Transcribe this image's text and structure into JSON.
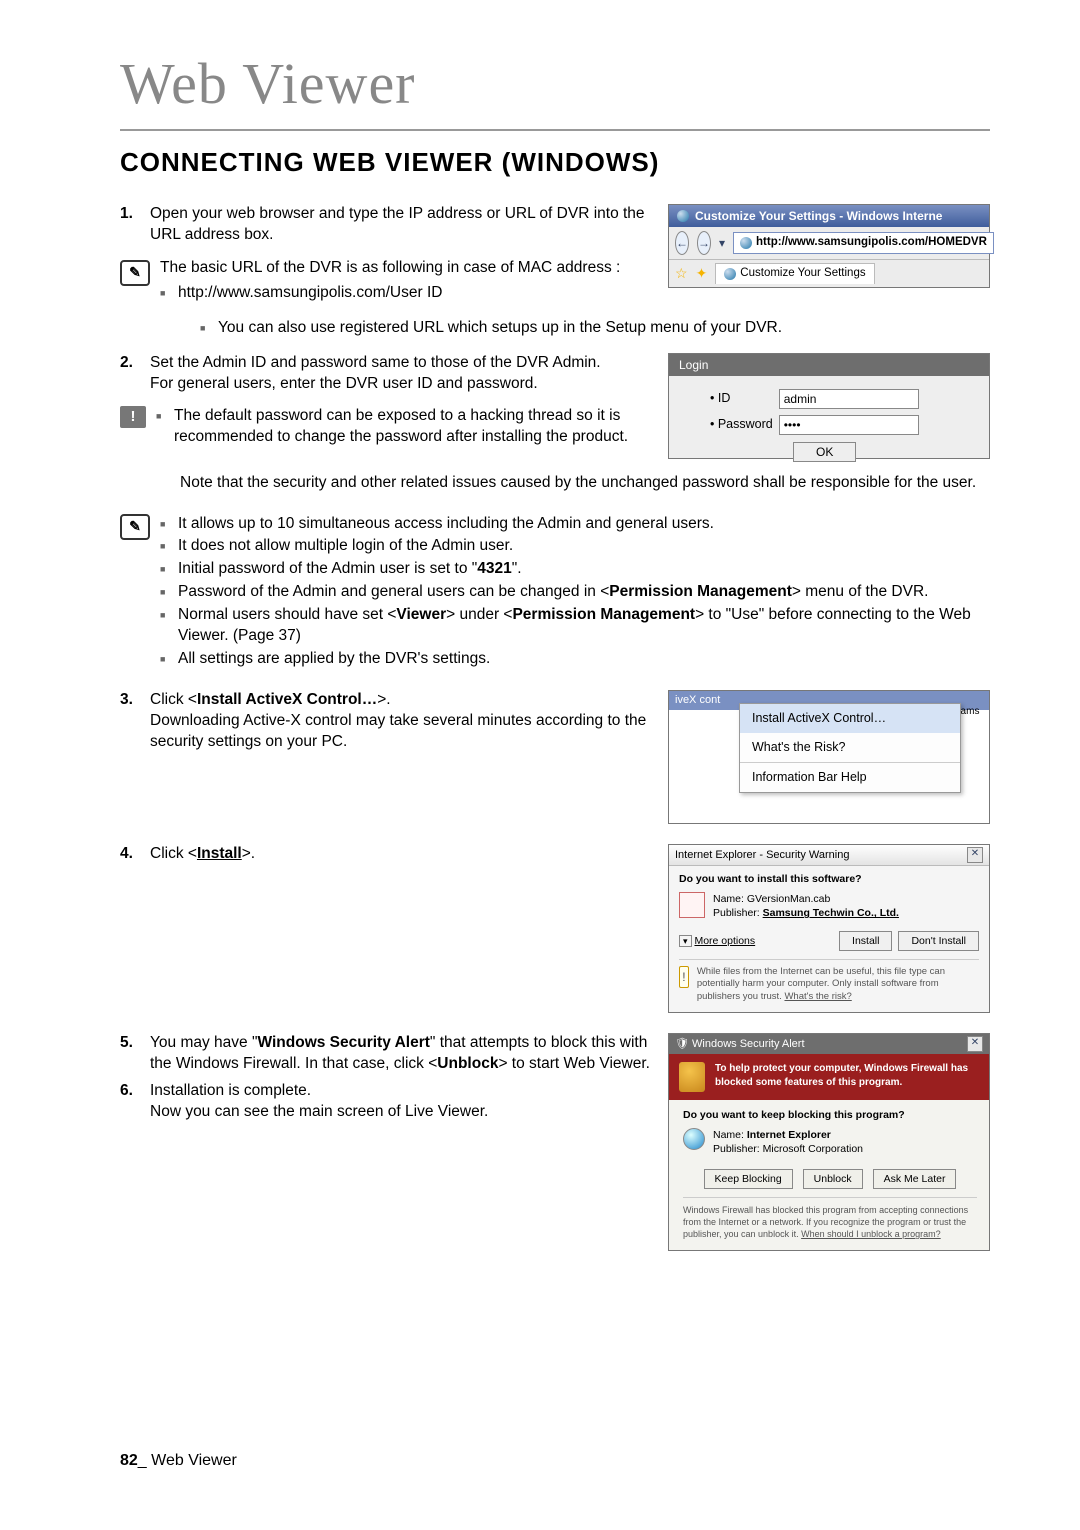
{
  "chapter_title": "Web Viewer",
  "section_heading": "CONNECTING WEB VIEWER (WINDOWS)",
  "steps": {
    "s1": {
      "num": "1.",
      "text": "Open your web browser and type the IP address or URL of DVR into the URL address box."
    },
    "note1": {
      "lead": "The basic URL of the DVR is as following in case of MAC address :",
      "b1": "http://www.samsungipolis.com/User ID",
      "b2": "You can also use registered URL which setups up in the Setup menu of your DVR."
    },
    "s2": {
      "num": "2.",
      "l1": "Set the Admin ID and password same to those of the DVR Admin.",
      "l2": "For general users, enter the DVR user ID and password."
    },
    "warn1": {
      "l1": "The default password can be exposed to a hacking thread so it is recommended to change the password after installing the product.",
      "l2": "Note that the security and other related issues caused by the unchanged password shall be responsible for the user."
    },
    "note2": {
      "b1": "It allows up to 10 simultaneous access including the Admin and general users.",
      "b2": "It does not allow multiple login of the Admin user.",
      "b3_pre": "Initial password of the Admin user is set to \"",
      "b3_bold": "4321",
      "b3_post": "\".",
      "b4_pre": "Password of the Admin and general users can be changed in <",
      "b4_bold": "Permission Management",
      "b4_post": "> menu of the DVR.",
      "b5_pre": "Normal users should have set <",
      "b5_b1": "Viewer",
      "b5_mid": "> under <",
      "b5_b2": "Permission Management",
      "b5_post": "> to \"Use\" before connecting to the Web Viewer. (Page 37)",
      "b6": "All settings are applied by the DVR's settings."
    },
    "s3": {
      "num": "3.",
      "l1_pre": "Click <",
      "l1_bold": "Install ActiveX Control…",
      "l1_post": ">.",
      "l2": "Downloading Active-X control may take several minutes according to the security settings on your PC."
    },
    "s4": {
      "num": "4.",
      "l1_pre": "Click <",
      "l1_bold": "Install",
      "l1_post": ">."
    },
    "s5": {
      "num": "5.",
      "l1_pre": "You may have \"",
      "l1_bold": "Windows Security Alert",
      "l1_mid": "\" that attempts to block this with the Windows Firewall. In that case, click <",
      "l1_bold2": "Unblock",
      "l1_post": "> to start Web Viewer."
    },
    "s6": {
      "num": "6.",
      "l1": "Installation is complete.",
      "l2": "Now you can see the main screen of Live Viewer."
    }
  },
  "ie_shot": {
    "title": "Customize Your Settings - Windows Interne",
    "url": "http://www.samsungipolis.com/HOMEDVR",
    "tab": "Customize Your Settings"
  },
  "login_shot": {
    "title": "Login",
    "id_label": "• ID",
    "id_value": "admin",
    "pw_label": "• Password",
    "pw_value": "••••",
    "ok": "OK"
  },
  "ax_shot": {
    "bar_left": "iveX cont",
    "bar_right": "ams",
    "m1": "Install ActiveX Control…",
    "m2": "What's the Risk?",
    "m3": "Information Bar Help"
  },
  "sw_shot": {
    "title": "Internet Explorer - Security Warning",
    "q": "Do you want to install this software?",
    "name_label": "Name:",
    "name_value": "GVersionMan.cab",
    "pub_label": "Publisher:",
    "pub_value": "Samsung Techwin Co., Ltd.",
    "more": "More options",
    "install": "Install",
    "dont": "Don't Install",
    "info": "While files from the Internet can be useful, this file type can potentially harm your computer. Only install software from publishers you trust.",
    "info_link": "What's the risk?"
  },
  "fw_shot": {
    "title": "Windows Security Alert",
    "banner": "To help protect your computer, Windows Firewall has blocked some features of this program.",
    "q": "Do you want to keep blocking this program?",
    "name_label": "Name:",
    "name_value": "Internet Explorer",
    "pub_label": "Publisher:",
    "pub_value": "Microsoft Corporation",
    "keep": "Keep Blocking",
    "unblock": "Unblock",
    "ask": "Ask Me Later",
    "footer": "Windows Firewall has blocked this program from accepting connections from the Internet or a network. If you recognize the program or trust the publisher, you can unblock it.",
    "footer_link": "When should I unblock a program?"
  },
  "footer": {
    "page_num": "82",
    "sep": "_",
    "label": "Web Viewer"
  }
}
